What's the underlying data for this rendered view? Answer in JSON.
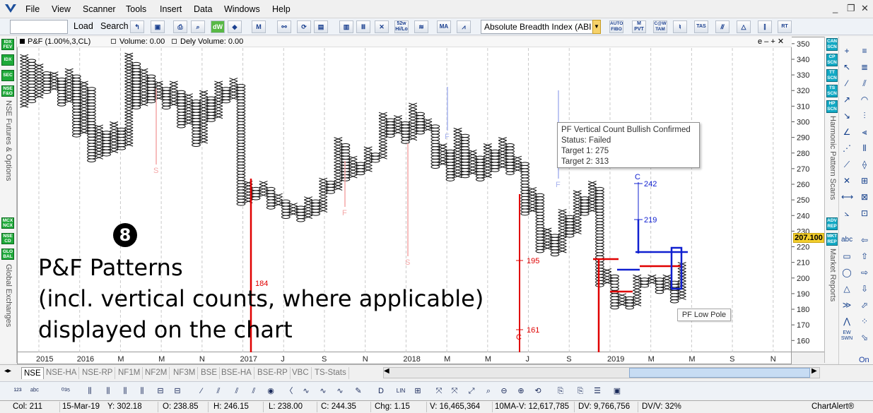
{
  "menu": {
    "items": [
      "File",
      "View",
      "Scanner",
      "Tools",
      "Insert",
      "Data",
      "Windows",
      "Help"
    ]
  },
  "window_controls": {
    "minimize": "_",
    "restore": "❐",
    "close": "✕"
  },
  "toolbar": {
    "load_label": "Load",
    "search_label": "Search",
    "symbol_value": "",
    "study_select": "Absolute Breadth Index (ABI",
    "icons": [
      "52w Hi/Lo",
      "MA",
      "AUTO FIBO",
      "M PVT",
      "C@W TAM",
      "TAS",
      "RT"
    ]
  },
  "left_panel": {
    "badges": [
      "IDX FEV",
      "IDX",
      "SEC",
      "NSE F&O",
      "MCX NCX",
      "NSE CD",
      "GLO BAL"
    ],
    "labels": [
      "NSE Futures & Options",
      "Global Exchanges"
    ]
  },
  "chart_header": {
    "symbol": "P&F (1.00%,3,CL)",
    "volume": "Volume: 0.00",
    "dely_volume": "Dely Volume: 0.00",
    "controls": "e – + ✕"
  },
  "chart_data": {
    "type": "point-and-figure",
    "title": "P&F (1.00%,3,CL)",
    "box_size": "1.00%",
    "reversal": 3,
    "price_field": "CL",
    "ylim": [
      152,
      354
    ],
    "y_ticks": [
      160,
      170,
      180,
      190,
      200,
      210,
      220,
      230,
      240,
      250,
      260,
      270,
      280,
      290,
      300,
      310,
      320,
      330,
      340,
      350
    ],
    "x_labels": [
      "2015",
      "2016",
      "M",
      "M",
      "N",
      "2017",
      "J",
      "S",
      "N",
      "2018",
      "M",
      "M",
      "J",
      "S",
      "2019",
      "M",
      "M",
      "S",
      "N"
    ],
    "columns": [
      {
        "type": "X",
        "low": 310,
        "high": 343
      },
      {
        "type": "O",
        "low": 312,
        "high": 340
      },
      {
        "type": "X",
        "low": 316,
        "high": 337
      },
      {
        "type": "O",
        "low": 318,
        "high": 332
      },
      {
        "type": "X",
        "low": 320,
        "high": 332
      },
      {
        "type": "O",
        "low": 310,
        "high": 328
      },
      {
        "type": "X",
        "low": 312,
        "high": 334
      },
      {
        "type": "O",
        "low": 290,
        "high": 330
      },
      {
        "type": "X",
        "low": 292,
        "high": 326
      },
      {
        "type": "O",
        "low": 274,
        "high": 322
      },
      {
        "type": "X",
        "low": 276,
        "high": 298
      },
      {
        "type": "O",
        "low": 278,
        "high": 294
      },
      {
        "type": "X",
        "low": 280,
        "high": 300
      },
      {
        "type": "O",
        "low": 282,
        "high": 296
      },
      {
        "type": "X",
        "low": 284,
        "high": 344
      },
      {
        "type": "O",
        "low": 308,
        "high": 338
      },
      {
        "type": "X",
        "low": 310,
        "high": 334
      },
      {
        "type": "O",
        "low": 312,
        "high": 330
      },
      {
        "type": "X",
        "low": 314,
        "high": 326
      },
      {
        "type": "O",
        "low": 308,
        "high": 322
      },
      {
        "type": "X",
        "low": 310,
        "high": 326
      },
      {
        "type": "O",
        "low": 296,
        "high": 320
      },
      {
        "type": "X",
        "low": 298,
        "high": 318
      },
      {
        "type": "O",
        "low": 284,
        "high": 314
      },
      {
        "type": "X",
        "low": 286,
        "high": 320
      },
      {
        "type": "O",
        "low": 300,
        "high": 316
      },
      {
        "type": "X",
        "low": 302,
        "high": 326
      },
      {
        "type": "O",
        "low": 312,
        "high": 322
      },
      {
        "type": "X",
        "low": 314,
        "high": 328
      },
      {
        "type": "O",
        "low": 246,
        "high": 324
      },
      {
        "type": "X",
        "low": 248,
        "high": 262
      },
      {
        "type": "O",
        "low": 250,
        "high": 258
      },
      {
        "type": "X",
        "low": 252,
        "high": 262
      },
      {
        "type": "O",
        "low": 244,
        "high": 258
      },
      {
        "type": "X",
        "low": 246,
        "high": 254
      },
      {
        "type": "O",
        "low": 238,
        "high": 250
      },
      {
        "type": "X",
        "low": 240,
        "high": 248
      },
      {
        "type": "O",
        "low": 236,
        "high": 246
      },
      {
        "type": "X",
        "low": 238,
        "high": 252
      },
      {
        "type": "O",
        "low": 240,
        "high": 250
      },
      {
        "type": "X",
        "low": 242,
        "high": 264
      },
      {
        "type": "O",
        "low": 254,
        "high": 262
      },
      {
        "type": "X",
        "low": 256,
        "high": 290
      },
      {
        "type": "O",
        "low": 262,
        "high": 286
      },
      {
        "type": "X",
        "low": 264,
        "high": 278
      },
      {
        "type": "O",
        "low": 266,
        "high": 274
      },
      {
        "type": "X",
        "low": 268,
        "high": 284
      },
      {
        "type": "O",
        "low": 274,
        "high": 280
      },
      {
        "type": "X",
        "low": 276,
        "high": 306
      },
      {
        "type": "O",
        "low": 290,
        "high": 302
      },
      {
        "type": "X",
        "low": 292,
        "high": 304
      },
      {
        "type": "O",
        "low": 286,
        "high": 300
      },
      {
        "type": "X",
        "low": 288,
        "high": 312
      },
      {
        "type": "O",
        "low": 292,
        "high": 306
      },
      {
        "type": "X",
        "low": 294,
        "high": 302
      },
      {
        "type": "O",
        "low": 270,
        "high": 298
      },
      {
        "type": "X",
        "low": 272,
        "high": 286
      },
      {
        "type": "O",
        "low": 262,
        "high": 282
      },
      {
        "type": "X",
        "low": 264,
        "high": 296
      },
      {
        "type": "O",
        "low": 264,
        "high": 292
      },
      {
        "type": "X",
        "low": 266,
        "high": 282
      },
      {
        "type": "O",
        "low": 262,
        "high": 278
      },
      {
        "type": "X",
        "low": 264,
        "high": 286
      },
      {
        "type": "O",
        "low": 268,
        "high": 282
      },
      {
        "type": "X",
        "low": 270,
        "high": 290
      },
      {
        "type": "O",
        "low": 266,
        "high": 286
      },
      {
        "type": "X",
        "low": 268,
        "high": 278
      },
      {
        "type": "O",
        "low": 240,
        "high": 274
      },
      {
        "type": "X",
        "low": 242,
        "high": 258
      },
      {
        "type": "O",
        "low": 216,
        "high": 254
      },
      {
        "type": "X",
        "low": 218,
        "high": 232
      },
      {
        "type": "O",
        "low": 214,
        "high": 228
      },
      {
        "type": "X",
        "low": 216,
        "high": 244
      },
      {
        "type": "O",
        "low": 226,
        "high": 240
      },
      {
        "type": "X",
        "low": 228,
        "high": 256
      },
      {
        "type": "O",
        "low": 240,
        "high": 252
      },
      {
        "type": "X",
        "low": 242,
        "high": 262
      },
      {
        "type": "O",
        "low": 194,
        "high": 258
      },
      {
        "type": "X",
        "low": 196,
        "high": 206
      },
      {
        "type": "O",
        "low": 180,
        "high": 202
      },
      {
        "type": "X",
        "low": 182,
        "high": 190
      },
      {
        "type": "O",
        "low": 180,
        "high": 188
      },
      {
        "type": "X",
        "low": 182,
        "high": 202
      },
      {
        "type": "O",
        "low": 194,
        "high": 200
      },
      {
        "type": "X",
        "low": 196,
        "high": 202
      },
      {
        "type": "O",
        "low": 190,
        "high": 200
      },
      {
        "type": "X",
        "low": 192,
        "high": 202
      },
      {
        "type": "O",
        "low": 184,
        "high": 198
      },
      {
        "type": "X",
        "low": 186,
        "high": 210
      }
    ],
    "vertical_counts": [
      {
        "label": "184",
        "color": "red"
      },
      {
        "label": "195",
        "color": "red"
      },
      {
        "label": "161",
        "color": "red"
      },
      {
        "label": "C",
        "color": "red"
      },
      {
        "label": "242",
        "color": "blue"
      },
      {
        "label": "219",
        "color": "blue"
      },
      {
        "label": "C",
        "color": "blue"
      }
    ],
    "faded_markers": [
      "S",
      "F",
      "S",
      "F"
    ]
  },
  "price_axis": {
    "current_price": "207.100"
  },
  "tooltip": {
    "title": "PF Vertical Count Bullish Confirmed",
    "status": "Status: Failed",
    "target1": "Target 1: 275",
    "target2": "Target 2: 313"
  },
  "pattern_label": "PF Low Pole",
  "overlay": {
    "badge": "8",
    "line1": "P&F Patterns",
    "line2": "(incl. vertical counts, where applicable)",
    "line3": "displayed on the chart"
  },
  "right_panel": {
    "badges": [
      "CAN SCN",
      "CP SCN",
      "TT SCN",
      "TS SCN",
      "HP SCN",
      "ADV REP",
      "MKT REP"
    ],
    "labels": [
      "Harmonic Pattern Scans",
      "Market Reports"
    ],
    "on_label": "On",
    "ew_label": "EW SWN"
  },
  "tabs": [
    "NSE",
    "NSE-HA",
    "NSE-RP",
    "NF1M",
    "NF2M",
    "NF3M",
    "BSE",
    "BSE-HA",
    "BSE-RP",
    "VBC",
    "TS-Stats"
  ],
  "active_tab": "NSE",
  "status_bar": {
    "col": "Col: 211",
    "date": "15-Mar-19",
    "y": "Y: 302.18",
    "open": "O: 238.85",
    "high": "H: 246.15",
    "low": "L: 238.00",
    "close": "C: 244.35",
    "change": "Chg: 1.15",
    "volume": "V: 16,465,364",
    "ma_volume": "10MA-V: 12,617,785",
    "dv": "DV: 9,766,756",
    "dv_v": "DV/V: 32%",
    "brand": "ChartAlert®"
  },
  "colors": {
    "count_red": "#e00000",
    "count_blue": "#1020d0",
    "faded_red": "#f4a7a7",
    "faded_blue": "#a8b4ef",
    "price_tag": "#f3ce2b"
  }
}
